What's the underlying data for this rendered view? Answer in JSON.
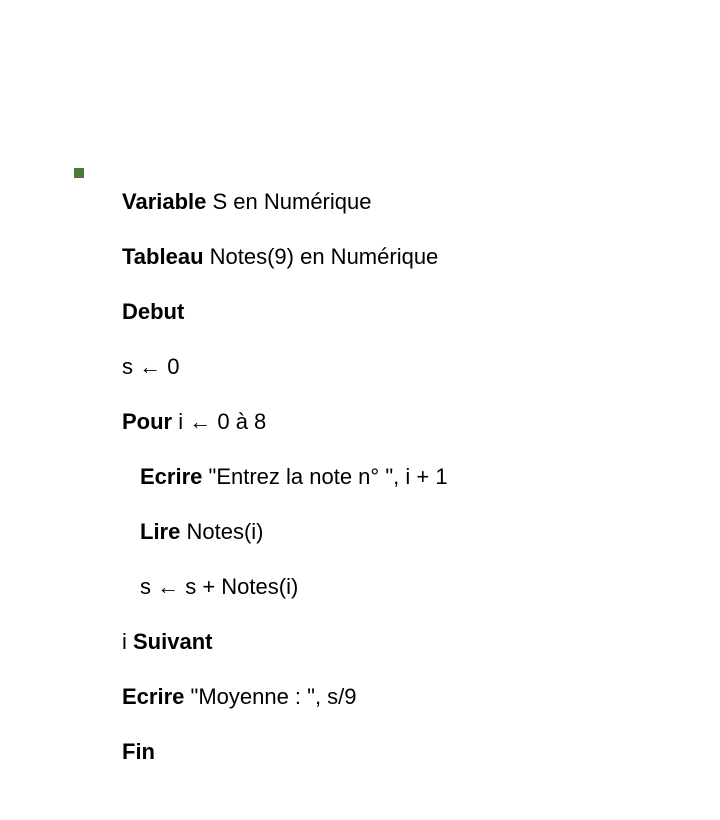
{
  "lines": {
    "l1_kw": "Variable",
    "l1_rest": " S en Numérique",
    "l2_kw": "Tableau",
    "l2_rest": " Notes(9) en Numérique",
    "l3": "Debut",
    "l4": "s ← 0",
    "l5_kw": "Pour",
    "l5_rest": " i ← 0 à 8",
    "l6_kw": "Ecrire",
    "l6_rest": " \"Entrez la note n° \", i + 1",
    "l7_kw": "Lire",
    "l7_rest": " Notes(i)",
    "l8": "s ← s + Notes(i)",
    "l9_pre": "i ",
    "l9_kw": "Suivant",
    "l10_kw": "Ecrire",
    "l10_rest": " \"Moyenne : \", s/9",
    "l11": "Fin"
  }
}
